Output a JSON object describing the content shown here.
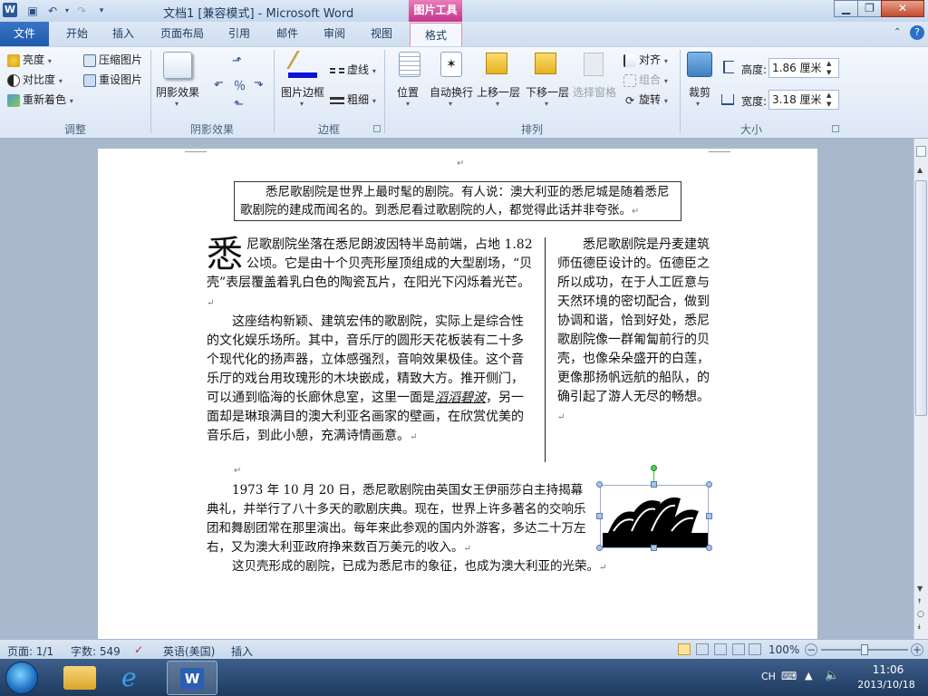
{
  "window": {
    "title": "文档1 [兼容模式] - Microsoft Word",
    "contextual_tab": "图片工具",
    "app_icon": "W"
  },
  "tabs": [
    "文件",
    "开始",
    "插入",
    "页面布局",
    "引用",
    "邮件",
    "审阅",
    "视图",
    "格式"
  ],
  "ribbon": {
    "adjust": {
      "label": "调整",
      "brightness": "亮度",
      "contrast": "对比度",
      "recolor": "重新着色",
      "compress": "压缩图片",
      "reset": "重设图片"
    },
    "shadow": {
      "label": "阴影效果",
      "button": "阴影效果"
    },
    "border": {
      "label": "边框",
      "picture_border": "图片边框",
      "dash": "虚线",
      "weight": "粗细"
    },
    "arrange": {
      "label": "排列",
      "position": "位置",
      "wrap": "自动换行",
      "bring_forward": "上移一层",
      "send_backward": "下移一层",
      "selection_pane": "选择窗格",
      "align": "对齐",
      "group": "组合",
      "rotate": "旋转"
    },
    "size": {
      "label": "大小",
      "crop": "裁剪",
      "height_label": "高度:",
      "height_value": "1.86 厘米",
      "width_label": "宽度:",
      "width_value": "3.18 厘米"
    }
  },
  "document": {
    "textbox": "悉尼歌剧院是世界上最时髦的剧院。有人说：澳大利亚的悉尼城是随着悉尼歌剧院的建成而闻名的。到悉尼看过歌剧院的人，都觉得此话并非夸张。",
    "drop_cap": "悉",
    "col1_p1": "尼歌剧院坐落在悉尼朗波因特半岛前端，占地 1.82 公顷。它是由十个贝壳形屋顶组成的大型剧场，“贝壳”表层覆盖着乳白色的陶瓷瓦片，在阳光下闪烁着光芒。",
    "col1_p2_a": "这座结构新颖、建筑宏伟的歌剧院，实际上是综合性的文化娱乐场所。其中，音乐厅的圆形天花板装有二十多个现代化的扬声器，立体感强烈，音响效果极佳。这个音乐厅的戏台用玫瑰形的木块嵌成，精致大方。推开侧门，可以通到临海的长廊休息室，这里一面是",
    "col1_p2_em": "滔滔碧波",
    "col1_p2_b": "，另一面却是琳琅满目的澳大利亚名画家的壁画，在欣赏优美的音乐后，到此小憩，充满诗情画意。",
    "col2": "悉尼歌剧院是丹麦建筑师伍德臣设计的。伍德臣之所以成功，在于人工匠意与天然环境的密切配合，做到协调和谐，恰到好处，悉尼歌剧院像一群匍匐前行的贝壳，也像朵朵盛开的白莲，更像那扬帆远航的船队，的确引起了游人无尽的畅想。",
    "p3": "1973 年 10 月 20 日，悉尼歌剧院由英国女王伊丽莎白主持揭幕典礼，并举行了八十多天的歌剧庆典。现在，世界上许多著名的交响乐团和舞剧团常在那里演出。每年来此参观的国内外游客，多达二十万左右，又为澳大利亚政府挣来数百万美元的收入。",
    "p4": "这贝壳形成的剧院，已成为悉尼市的象征，也成为澳大利亚的光荣。",
    "para_mark": "↵"
  },
  "statusbar": {
    "page": "页面: 1/1",
    "words": "字数: 549",
    "language": "英语(美国)",
    "mode": "插入",
    "zoom": "100%"
  },
  "taskbar": {
    "ime": "CH",
    "time": "11:06",
    "date": "2013/10/18"
  },
  "colors": {
    "file_tab": "#2b5fb4",
    "contextual": "#c5358c",
    "taskbar": "#1e3a5f"
  }
}
